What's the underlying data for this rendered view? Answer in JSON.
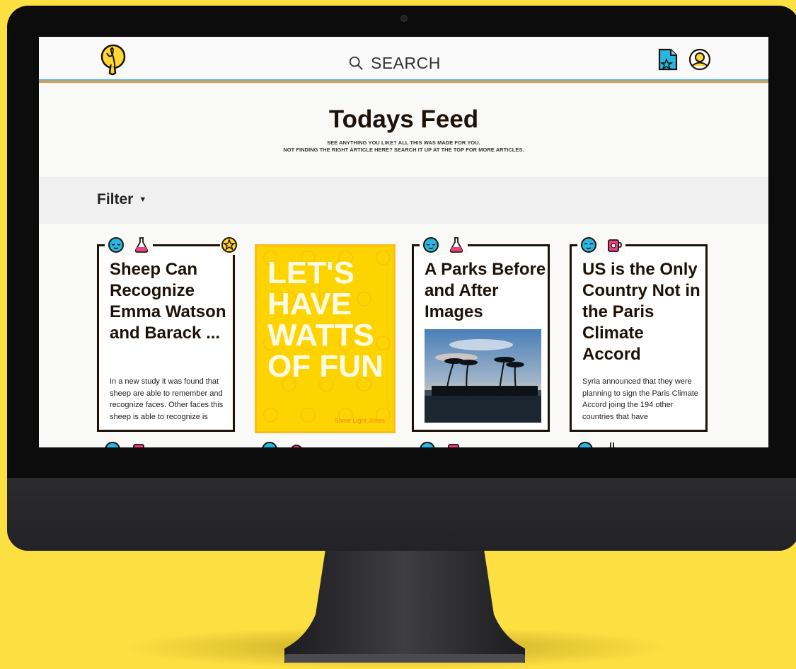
{
  "header": {
    "search_label": "SEARCH",
    "icons": [
      "lightbulb-logo-icon",
      "search-icon",
      "saved-document-icon",
      "user-account-icon"
    ],
    "stripe_colors": [
      "#42b8e6",
      "#fbb536",
      "#f08a3c"
    ]
  },
  "feed": {
    "title": "Todays Feed",
    "subtitle_line1": "SEE ANYTHING YOU LIKE? ALL THIS WAS MADE FOR YOU.",
    "subtitle_line2": "NOT FINDING THE RIGHT ARTICLE HERE? SEARCH IT UP AT THE TOP FOR MORE ARTICLES."
  },
  "filter": {
    "label": "Filter"
  },
  "cards": [
    {
      "title": "Sheep Can Recognize Emma Watson and Barack ...",
      "body": "In a new study it was found that sheep are able to remember and recognize faces. Other faces this sheep is able to recognize is",
      "icons": [
        "blue-face-icon",
        "pink-flask-icon",
        "star-badge-icon"
      ]
    },
    {
      "promo_text": "LET'S HAVE WATTS OF FUN",
      "tag": "Some Light Jokes"
    },
    {
      "title": "A Parks Before and After Images",
      "icons": [
        "blue-face-icon",
        "pink-flask-icon"
      ],
      "image": "palm-trees-harbor-photo"
    },
    {
      "title": "US is the Only Country Not in the Paris Climate Accord",
      "body": "Syria announced that they were planning to sign the Paris Climate Accord joing the 194 other countries that have",
      "icons": [
        "blue-face-icon",
        "pink-mug-icon"
      ]
    }
  ],
  "colors": {
    "background": "#fcdf41",
    "accent_blue": "#29b6e3",
    "accent_pink": "#ee3f86",
    "promo_yellow": "#fed400",
    "text_dark": "#1e1208"
  }
}
